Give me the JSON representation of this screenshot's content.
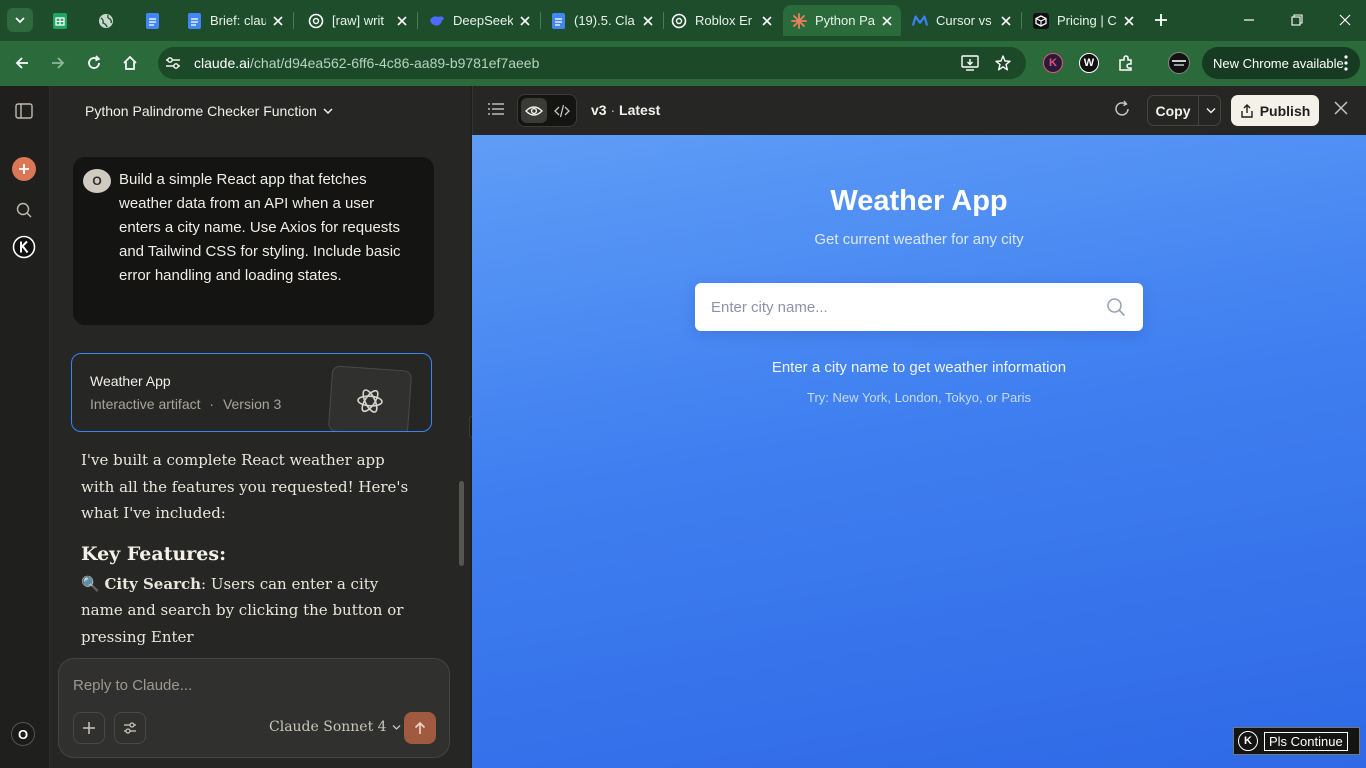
{
  "browser": {
    "tabs": [
      {
        "title": "",
        "icon": "sheets-icon"
      },
      {
        "title": "",
        "icon": "globe-icon"
      },
      {
        "title": "",
        "icon": "docs-icon"
      },
      {
        "title": "Brief: clau",
        "icon": "docs-icon"
      },
      {
        "title": "[raw] writ",
        "icon": "openai-icon"
      },
      {
        "title": "DeepSeek",
        "icon": "deepseek-icon"
      },
      {
        "title": "(19).5. Cla",
        "icon": "docs-icon"
      },
      {
        "title": "Roblox Er",
        "icon": "openai-icon"
      },
      {
        "title": "Python Pa",
        "icon": "claude-icon",
        "active": true
      },
      {
        "title": "Cursor vs",
        "icon": "m-icon"
      },
      {
        "title": "Pricing | C",
        "icon": "cube-icon"
      }
    ],
    "url_host": "claude.ai",
    "url_path": "/chat/d94ea562-6ff6-4c86-aa89-b9781ef7aeeb",
    "update_label": "New Chrome available",
    "theme_color": "#2b6a3b"
  },
  "chat": {
    "title": "Python Palindrome Checker Function",
    "user_initial": "O",
    "user_message": "Build a simple React app that fetches weather data from an API when a user enters a city name. Use Axios for requests and Tailwind CSS for styling. Include basic error handling and loading states.",
    "artifact": {
      "title": "Weather App",
      "kind": "Interactive artifact",
      "separator": "·",
      "version": "Version 3"
    },
    "response_intro": "I've built a complete React weather app with all the features you requested! Here's what I've included:",
    "features_heading": "Key Features:",
    "feature_1_emoji": "🔍",
    "feature_1_bold": "City Search",
    "feature_1_text": ": Users can enter a city name and search by clicking the button or pressing Enter",
    "composer_placeholder": "Reply to Claude...",
    "model_name": "Claude Sonnet 4",
    "rail_user_initial": "O",
    "accent_color": "#d97757"
  },
  "artifact_panel": {
    "version_label": "v3",
    "version_separator": " · ",
    "version_status": "Latest",
    "copy_label": "Copy",
    "publish_label": "Publish"
  },
  "preview": {
    "title": "Weather App",
    "subtitle": "Get current weather for any city",
    "search_placeholder": "Enter city name...",
    "info_text": "Enter a city name to get weather information",
    "hint_text": "Try: New York, London, Tokyo, or Paris",
    "background_color": "#3f7ff0"
  },
  "overlay": {
    "k_label": "K",
    "button_label": "Pls Continue"
  }
}
